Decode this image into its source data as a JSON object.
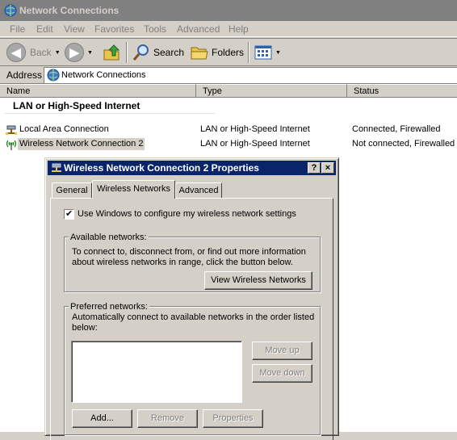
{
  "window": {
    "title": "Network Connections"
  },
  "menu": [
    "File",
    "Edit",
    "View",
    "Favorites",
    "Tools",
    "Advanced",
    "Help"
  ],
  "toolbar": {
    "back": "Back",
    "search": "Search",
    "folders": "Folders"
  },
  "address": {
    "label": "Address",
    "value": "Network Connections"
  },
  "columns": [
    "Name",
    "Type",
    "Status"
  ],
  "group_header": "LAN or High-Speed Internet",
  "rows": [
    {
      "name": "Local Area Connection",
      "type": "LAN or High-Speed Internet",
      "status": "Connected, Firewalled"
    },
    {
      "name": "Wireless Network Connection 2",
      "type": "LAN or High-Speed Internet",
      "status": "Not connected, Firewalled"
    }
  ],
  "dialog": {
    "title": "Wireless Network Connection 2 Properties",
    "help_btn": "?",
    "close_btn": "×",
    "tabs": [
      "General",
      "Wireless Networks",
      "Advanced"
    ],
    "use_windows_label": "Use Windows to configure my wireless network settings",
    "use_windows_checked": true,
    "available": {
      "legend": "Available networks:",
      "line1": "To connect to, disconnect from, or find out more information",
      "line2": "about wireless networks in range, click the button below.",
      "view_button": "View Wireless Networks"
    },
    "preferred": {
      "legend": "Preferred networks:",
      "line1": "Automatically connect to available networks in the order listed",
      "line2": "below:",
      "move_up": "Move up",
      "move_down": "Move down",
      "add": "Add...",
      "remove": "Remove",
      "properties": "Properties"
    }
  }
}
